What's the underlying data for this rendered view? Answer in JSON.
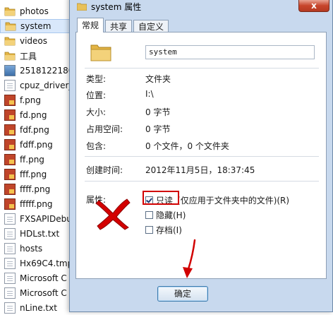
{
  "explorer": {
    "files": [
      {
        "name": "photos",
        "type": "folder",
        "selected": false
      },
      {
        "name": "system",
        "type": "folder",
        "selected": true
      },
      {
        "name": "videos",
        "type": "folder",
        "selected": false
      },
      {
        "name": "工具",
        "type": "folder",
        "selected": false
      },
      {
        "name": "2518122180",
        "type": "image",
        "selected": false
      },
      {
        "name": "cpuz_driver_",
        "type": "doc",
        "selected": false
      },
      {
        "name": "f.png",
        "type": "png",
        "selected": false
      },
      {
        "name": "fd.png",
        "type": "png",
        "selected": false
      },
      {
        "name": "fdf.png",
        "type": "png",
        "selected": false
      },
      {
        "name": "fdff.png",
        "type": "png",
        "selected": false
      },
      {
        "name": "ff.png",
        "type": "png",
        "selected": false
      },
      {
        "name": "fff.png",
        "type": "png",
        "selected": false
      },
      {
        "name": "ffff.png",
        "type": "png",
        "selected": false
      },
      {
        "name": "fffff.png",
        "type": "png",
        "selected": false
      },
      {
        "name": "FXSAPIDebu",
        "type": "doc",
        "selected": false
      },
      {
        "name": "HDLst.txt",
        "type": "doc",
        "selected": false
      },
      {
        "name": "hosts",
        "type": "doc",
        "selected": false
      },
      {
        "name": "Hx69C4.tmp",
        "type": "doc",
        "selected": false
      },
      {
        "name": "Microsoft C",
        "type": "doc",
        "selected": false
      },
      {
        "name": "Microsoft C",
        "type": "doc",
        "selected": false
      },
      {
        "name": "nLine.txt",
        "type": "doc",
        "selected": false
      }
    ]
  },
  "dialog": {
    "title": "system 属性",
    "close_label": "x",
    "tabs": [
      {
        "label": "常规",
        "active": true
      },
      {
        "label": "共享",
        "active": false
      },
      {
        "label": "自定义",
        "active": false
      }
    ],
    "name_value": "system",
    "props": [
      {
        "label": "类型:",
        "value": "文件夹"
      },
      {
        "label": "位置:",
        "value": "I:\\"
      },
      {
        "label": "大小:",
        "value": "0 字节"
      },
      {
        "label": "占用空间:",
        "value": "0 字节"
      },
      {
        "label": "包含:",
        "value": "0 个文件，0 个文件夹"
      },
      {
        "label": "创建时间:",
        "value": "2012年11月5日，18:37:45"
      }
    ],
    "attributes_label": "属性:",
    "attributes": [
      {
        "label": "只读",
        "extra": "(仅应用于文件夹中的文件)(R)",
        "checked": true
      },
      {
        "label": "隐藏(H)",
        "extra": "",
        "checked": false
      },
      {
        "label": "存档(I)",
        "extra": "",
        "checked": false
      }
    ],
    "ok_label": "确定"
  },
  "colors": {
    "annotation_red": "#d10000",
    "dialog_frame": "#c8d9ee",
    "selection": "#d9e8fb"
  }
}
